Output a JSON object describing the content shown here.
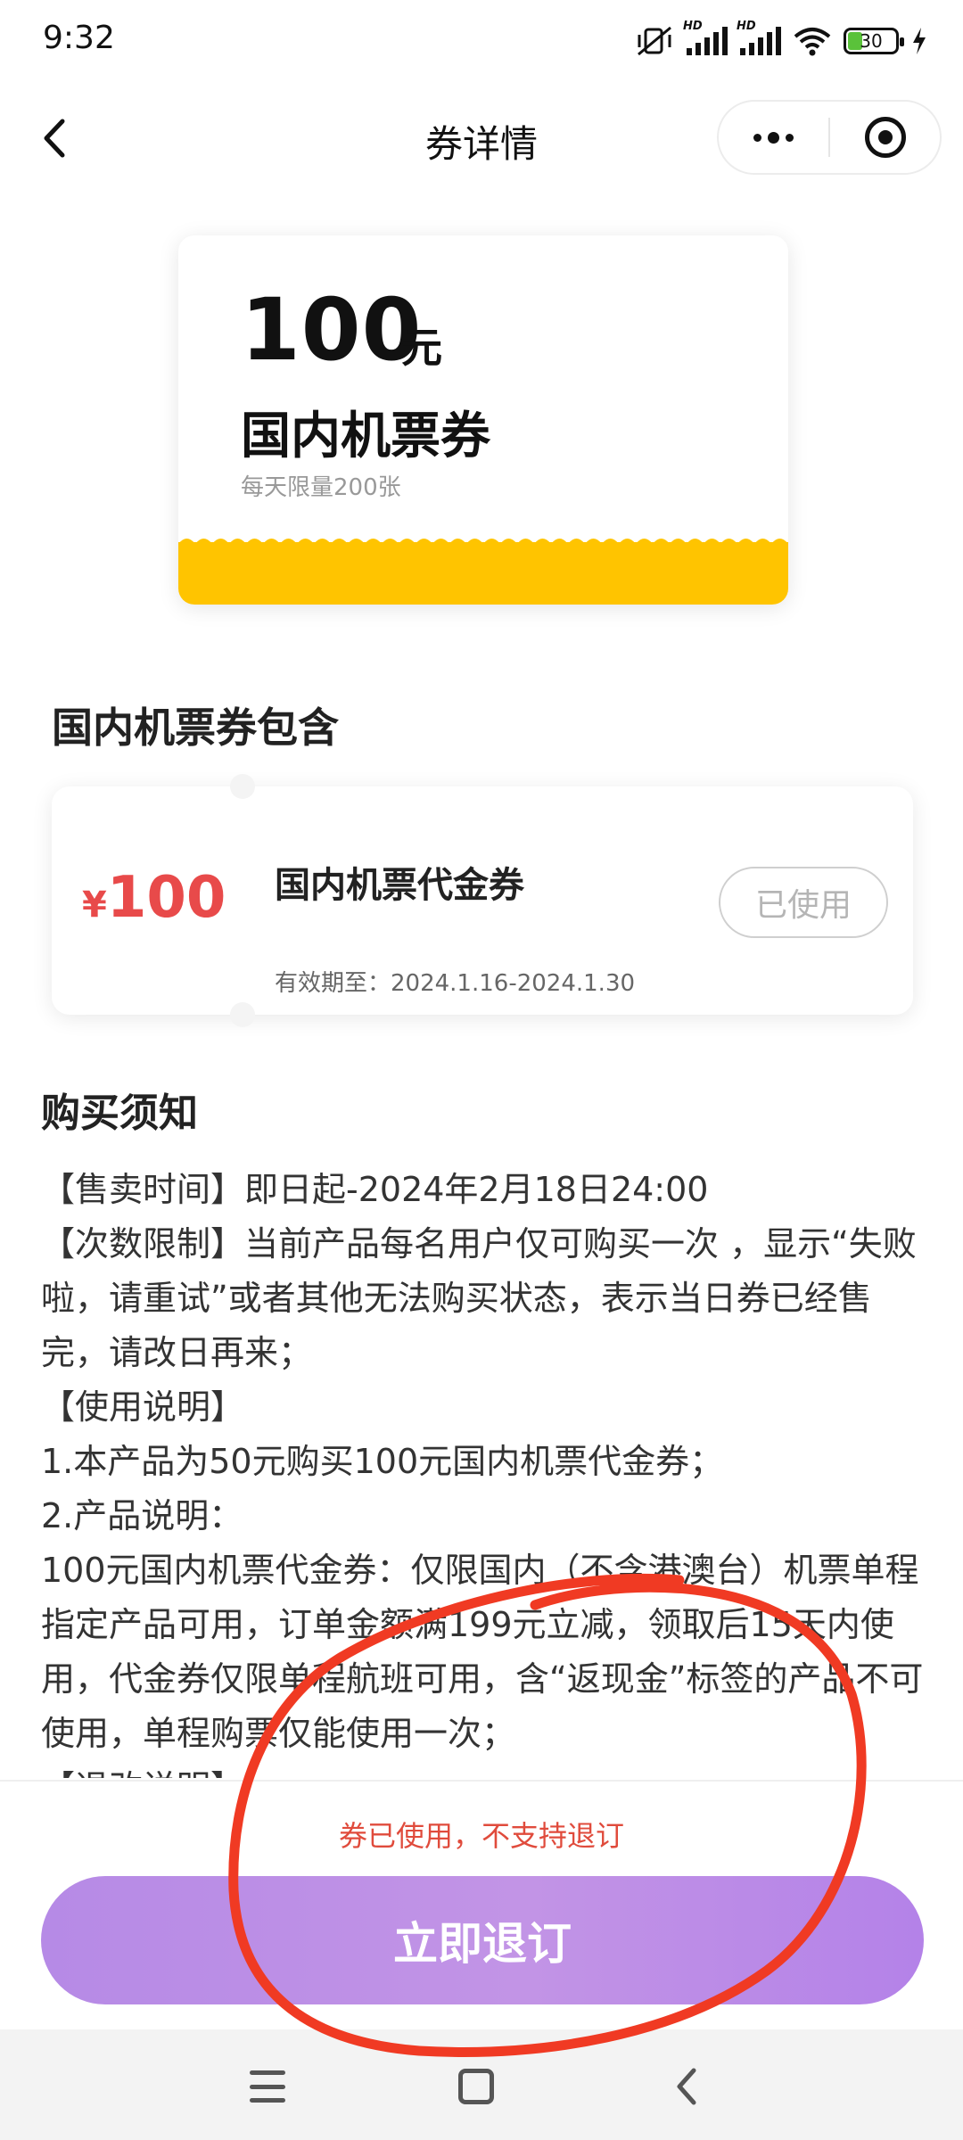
{
  "status_bar": {
    "time": "9:32",
    "battery_level": "30",
    "network_labels": [
      "HD",
      "HD"
    ],
    "icons": [
      "mute-vibrate-icon",
      "signal-icon",
      "signal-icon",
      "wifi-icon",
      "battery-icon",
      "charging-icon"
    ]
  },
  "nav": {
    "title": "券详情",
    "icons": [
      "back-arrow-icon",
      "more-dots-icon",
      "record-target-icon"
    ]
  },
  "coupon": {
    "amount": "100",
    "unit": "元",
    "name": "国内机票券",
    "limit_text": "每天限量200张",
    "accent_color": "#ffc400"
  },
  "included": {
    "title": "国内机票券包含",
    "voucher": {
      "currency": "¥",
      "price": "100",
      "name": "国内机票代金券",
      "validity": "有效期至：2024.1.16-2024.1.30",
      "status": "已使用",
      "price_color": "#e84a4a"
    }
  },
  "notice": {
    "title": "购买须知",
    "lines": [
      "【售卖时间】即日起-2024年2月18日24:00",
      "【次数限制】当前产品每名用户仅可购买一次 ，显示“失败啦，请重试”或者其他无法购买状态，表示当日券已经售完，请改日再来；",
      "【使用说明】",
      "1.本产品为50元购买100元国内机票代金券；",
      "2.产品说明：",
      "100元国内机票代金券：仅限国内（不含港澳台）机票单程指定产品可用，订单金额满199元立减，领取后15天内使用，代金券仅限单程航班可用，含“返现金”标签的产品不可使用，单程购票仅能使用一次；",
      "【退改说明】"
    ]
  },
  "bottom": {
    "refund_hint": "券已使用，不支持退订",
    "refund_button": "立即退订",
    "button_color": "#b68ae6"
  },
  "system_nav": {
    "icons": [
      "menu-icon",
      "home-icon",
      "back-icon"
    ]
  }
}
